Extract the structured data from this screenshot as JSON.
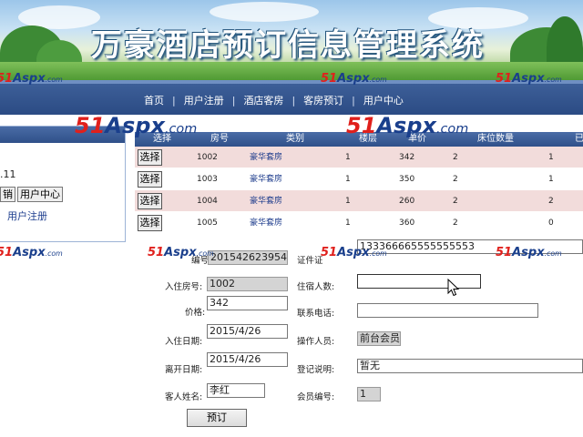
{
  "banner": {
    "title": "万豪酒店预订信息管理系统"
  },
  "nav": {
    "items": [
      "首页",
      "用户注册",
      "酒店客房",
      "客房预订",
      "用户中心"
    ],
    "separator": "|"
  },
  "sidebar": {
    "time_fragment": ".11",
    "buttons": [
      "销",
      "用户中心"
    ],
    "register_link": "用户注册"
  },
  "table": {
    "headers": [
      "选择",
      "房号",
      "类别",
      "楼层",
      "单价",
      "床位数量",
      "已"
    ],
    "rows": [
      {
        "select": "选择",
        "room": "1002",
        "type": "豪华套房",
        "floor": "1",
        "price": "342",
        "beds": "2",
        "booked": "1"
      },
      {
        "select": "选择",
        "room": "1003",
        "type": "豪华套房",
        "floor": "1",
        "price": "350",
        "beds": "2",
        "booked": "1"
      },
      {
        "select": "选择",
        "room": "1004",
        "type": "豪华套房",
        "floor": "1",
        "price": "260",
        "beds": "2",
        "booked": "2"
      },
      {
        "select": "选择",
        "room": "1005",
        "type": "豪华套房",
        "floor": "1",
        "price": "360",
        "beds": "2",
        "booked": "0"
      }
    ]
  },
  "form": {
    "order_no": {
      "label": "编号",
      "value": "201542623954"
    },
    "room_no": {
      "label": "入住房号:",
      "value": "1002"
    },
    "price": {
      "label": "价格:",
      "value": "342"
    },
    "checkin": {
      "label": "入住日期:",
      "value": "2015/4/26"
    },
    "checkout": {
      "label": "离开日期:",
      "value": "2015/4/26"
    },
    "guest_name": {
      "label": "客人姓名:",
      "value": "李红"
    },
    "id_no": {
      "label": "证件证",
      "value": "133366665555555553"
    },
    "guests": {
      "label": "住宿人数:",
      "value": ""
    },
    "phone": {
      "label": "联系电话:",
      "value": ""
    },
    "operator": {
      "label": "操作人员:",
      "value": "前台会员"
    },
    "note": {
      "label": "登记说明:",
      "value": "暂无"
    },
    "member_no": {
      "label": "会员编号:",
      "value": "1"
    },
    "submit": "预订"
  },
  "watermark": {
    "num": "51",
    "brand": "Aspx",
    "suffix": ".com"
  },
  "colors": {
    "nav_bg": "#2b4b84",
    "header_bg": "#3a5c96",
    "row_alt": "#f2dcdb",
    "watermark_red": "#e0201c",
    "watermark_blue": "#1a3f8c"
  }
}
